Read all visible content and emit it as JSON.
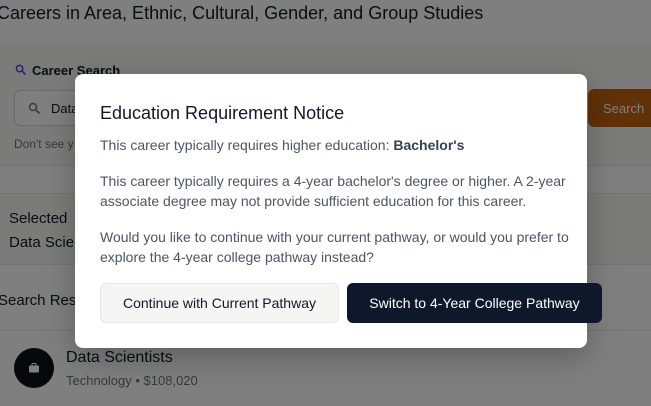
{
  "page": {
    "title": "Careers in Area, Ethnic, Cultural, Gender, and Group Studies"
  },
  "career_search": {
    "heading": "Career Search",
    "icon": "search-icon",
    "input_value": "Data",
    "button_label": "Search",
    "help_text": "Don't see y"
  },
  "selected": {
    "label": "Selected",
    "value": "Data Scie"
  },
  "results": {
    "heading": "Search Res",
    "items": [
      {
        "title": "Data Scientists",
        "meta": "Technology • $108,020",
        "icon": "briefcase-icon"
      }
    ]
  },
  "modal": {
    "title": "Education Requirement Notice",
    "requirement_prefix": "This career typically requires higher education: ",
    "requirement_value": "Bachelor's",
    "explanation_line1": "This career typically requires a 4-year bachelor's degree or higher. A 2-year",
    "explanation_line2": "associate degree may not provide sufficient education for this career.",
    "question_line1": "Would you like to continue with your current pathway, or would you prefer to",
    "question_line2": "explore the 4-year college pathway instead?",
    "secondary_button": "Continue with Current Pathway",
    "primary_button": "Switch to 4-Year College Pathway"
  },
  "colors": {
    "accent": "#c2620e",
    "primary_button": "#0f172a",
    "overlay": "rgba(0,0,0,0.5)"
  }
}
